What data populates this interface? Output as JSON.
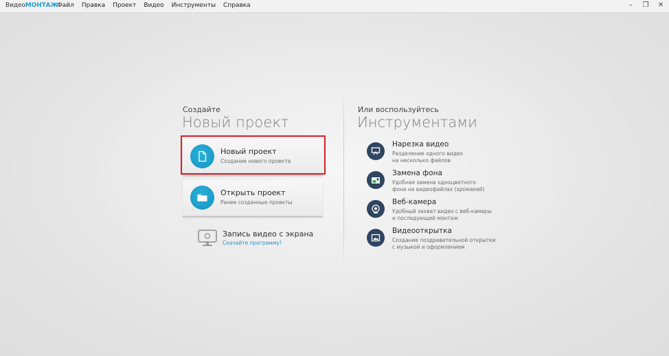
{
  "app": {
    "logo_prefix": "Видео",
    "logo_brand": "МОНТАЖ",
    "brand_color": "#1ea0d6"
  },
  "menu": [
    "Файл",
    "Правка",
    "Проект",
    "Видео",
    "Инструменты",
    "Справка"
  ],
  "window_controls": {
    "minimize": "–",
    "maximize": "❐",
    "close": "✕"
  },
  "create": {
    "subtitle": "Создайте",
    "title": "Новый проект",
    "new_project": {
      "title": "Новый проект",
      "subtitle": "Создание нового проекта",
      "icon": "document-icon"
    },
    "open_project": {
      "title": "Открыть проект",
      "subtitle": "Ранее созданные проекты",
      "icon": "folder-icon"
    },
    "screen_record": {
      "title": "Запись видео с экрана",
      "link": "Скачайте программу!",
      "icon": "monitor-icon"
    }
  },
  "tools": {
    "subtitle": "Или воспользуйтесь",
    "title": "Инструментами",
    "items": [
      {
        "title": "Нарезка видео",
        "desc_line1": "Разделение одного видео",
        "desc_line2": "на несколько файлов",
        "icon": "cut-screen-icon"
      },
      {
        "title": "Замена фона",
        "desc_line1": "Удобная замена одноцветного",
        "desc_line2": "фона на видеофайлах (хромакей)",
        "icon": "chroma-key-icon"
      },
      {
        "title": "Веб-камера",
        "desc_line1": "Удобный захват видео с веб-камеры",
        "desc_line2": "и последующий монтаж",
        "icon": "webcam-icon"
      },
      {
        "title": "Видеооткрытка",
        "desc_line1": "Создание поздравительной открытки",
        "desc_line2": "с музыкой и оформлением",
        "icon": "postcard-icon"
      }
    ]
  },
  "colors": {
    "card_icon": "#1ea0d6",
    "tool_icon": "#2f4560",
    "highlight": "#d41e26",
    "link": "#2392c7"
  }
}
